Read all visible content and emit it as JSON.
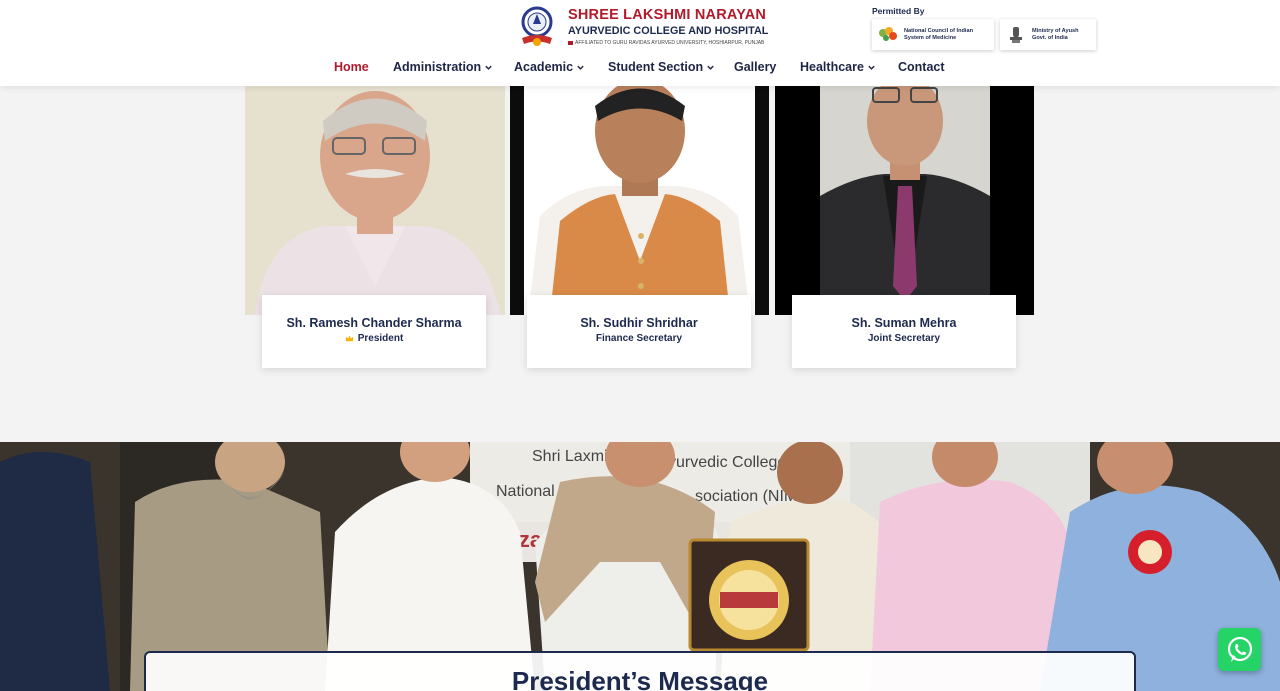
{
  "brand": {
    "name_line1": "SHREE LAKSHMI NARAYAN",
    "name_line2": "AYURVEDIC COLLEGE AND HOSPITAL",
    "affiliation": "AFFILIATED TO GURU RAVIDAS AYURVED UNIVERSITY, HOSHIARPUR, PUNJAB"
  },
  "permit": {
    "title": "Permitted By",
    "cards": [
      {
        "line1": "National Council of Indian",
        "line2": "System of Medicine",
        "icon": "ncism-logo"
      },
      {
        "line1": "Ministry of Ayush",
        "line2": "Govt. of India",
        "icon": "emblem-of-india"
      }
    ]
  },
  "nav": {
    "items": [
      {
        "label": "Home",
        "active": true,
        "dropdown": false
      },
      {
        "label": "Administration",
        "active": false,
        "dropdown": true
      },
      {
        "label": "Academic",
        "active": false,
        "dropdown": true
      },
      {
        "label": "Student Section",
        "active": false,
        "dropdown": true
      },
      {
        "label": "Gallery",
        "active": false,
        "dropdown": false
      },
      {
        "label": "Healthcare",
        "active": false,
        "dropdown": true
      },
      {
        "label": "Contact",
        "active": false,
        "dropdown": false
      }
    ]
  },
  "team": [
    {
      "name": "Sh. Ramesh Chander Sharma",
      "role": "President",
      "icon": "crown-icon"
    },
    {
      "name": "Sh. Sudhir Shridhar",
      "role": "Finance Secretary"
    },
    {
      "name": "Sh. Suman Mehra",
      "role": "Joint Secretary"
    }
  ],
  "event": {
    "banner_text_1": "Shri Laxmi",
    "banner_text_2": "yurvedic College,",
    "banner_text_3": "National Inte",
    "banner_text_4": "sociation (NIM",
    "banner_text_5": "Aza"
  },
  "message": {
    "title": "President’s Message"
  },
  "colors": {
    "navy": "#1d2a4f",
    "brand_red": "#b11a2a",
    "whatsapp": "#25d366"
  }
}
